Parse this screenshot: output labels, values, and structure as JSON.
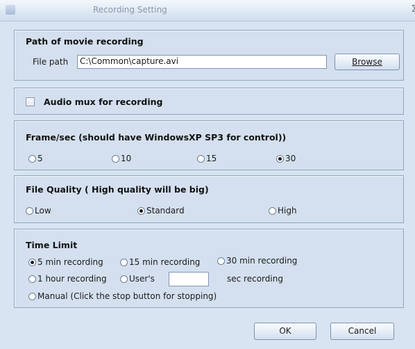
{
  "window": {
    "title": "Recording Setting",
    "close_glyph": "Σ"
  },
  "path_section": {
    "title": "Path of movie recording",
    "file_path_label": "File path",
    "file_path_value": "C:\\Common\\capture.avi",
    "browse_label": "Browse"
  },
  "audio_section": {
    "label": "Audio mux for recording",
    "checked": false
  },
  "fps_section": {
    "title": "Frame/sec (should have WindowsXP SP3 for control))",
    "options": [
      "5",
      "10",
      "15",
      "30"
    ],
    "selected": "30"
  },
  "quality_section": {
    "title": "File Quality ( High quality will be big)",
    "options": [
      "Low",
      "Standard",
      "High"
    ],
    "selected": "Standard"
  },
  "time_section": {
    "title": "Time Limit",
    "opt_5min": "5 min recording",
    "opt_15min": "15 min recording",
    "opt_30min": "30 min recording",
    "opt_1hour": "1 hour recording",
    "opt_users": "User's",
    "users_value": "",
    "sec_recording": "sec recording",
    "opt_manual": "Manual (Click the stop button for stopping)",
    "selected": "5 min recording"
  },
  "buttons": {
    "ok": "OK",
    "cancel": "Cancel"
  }
}
